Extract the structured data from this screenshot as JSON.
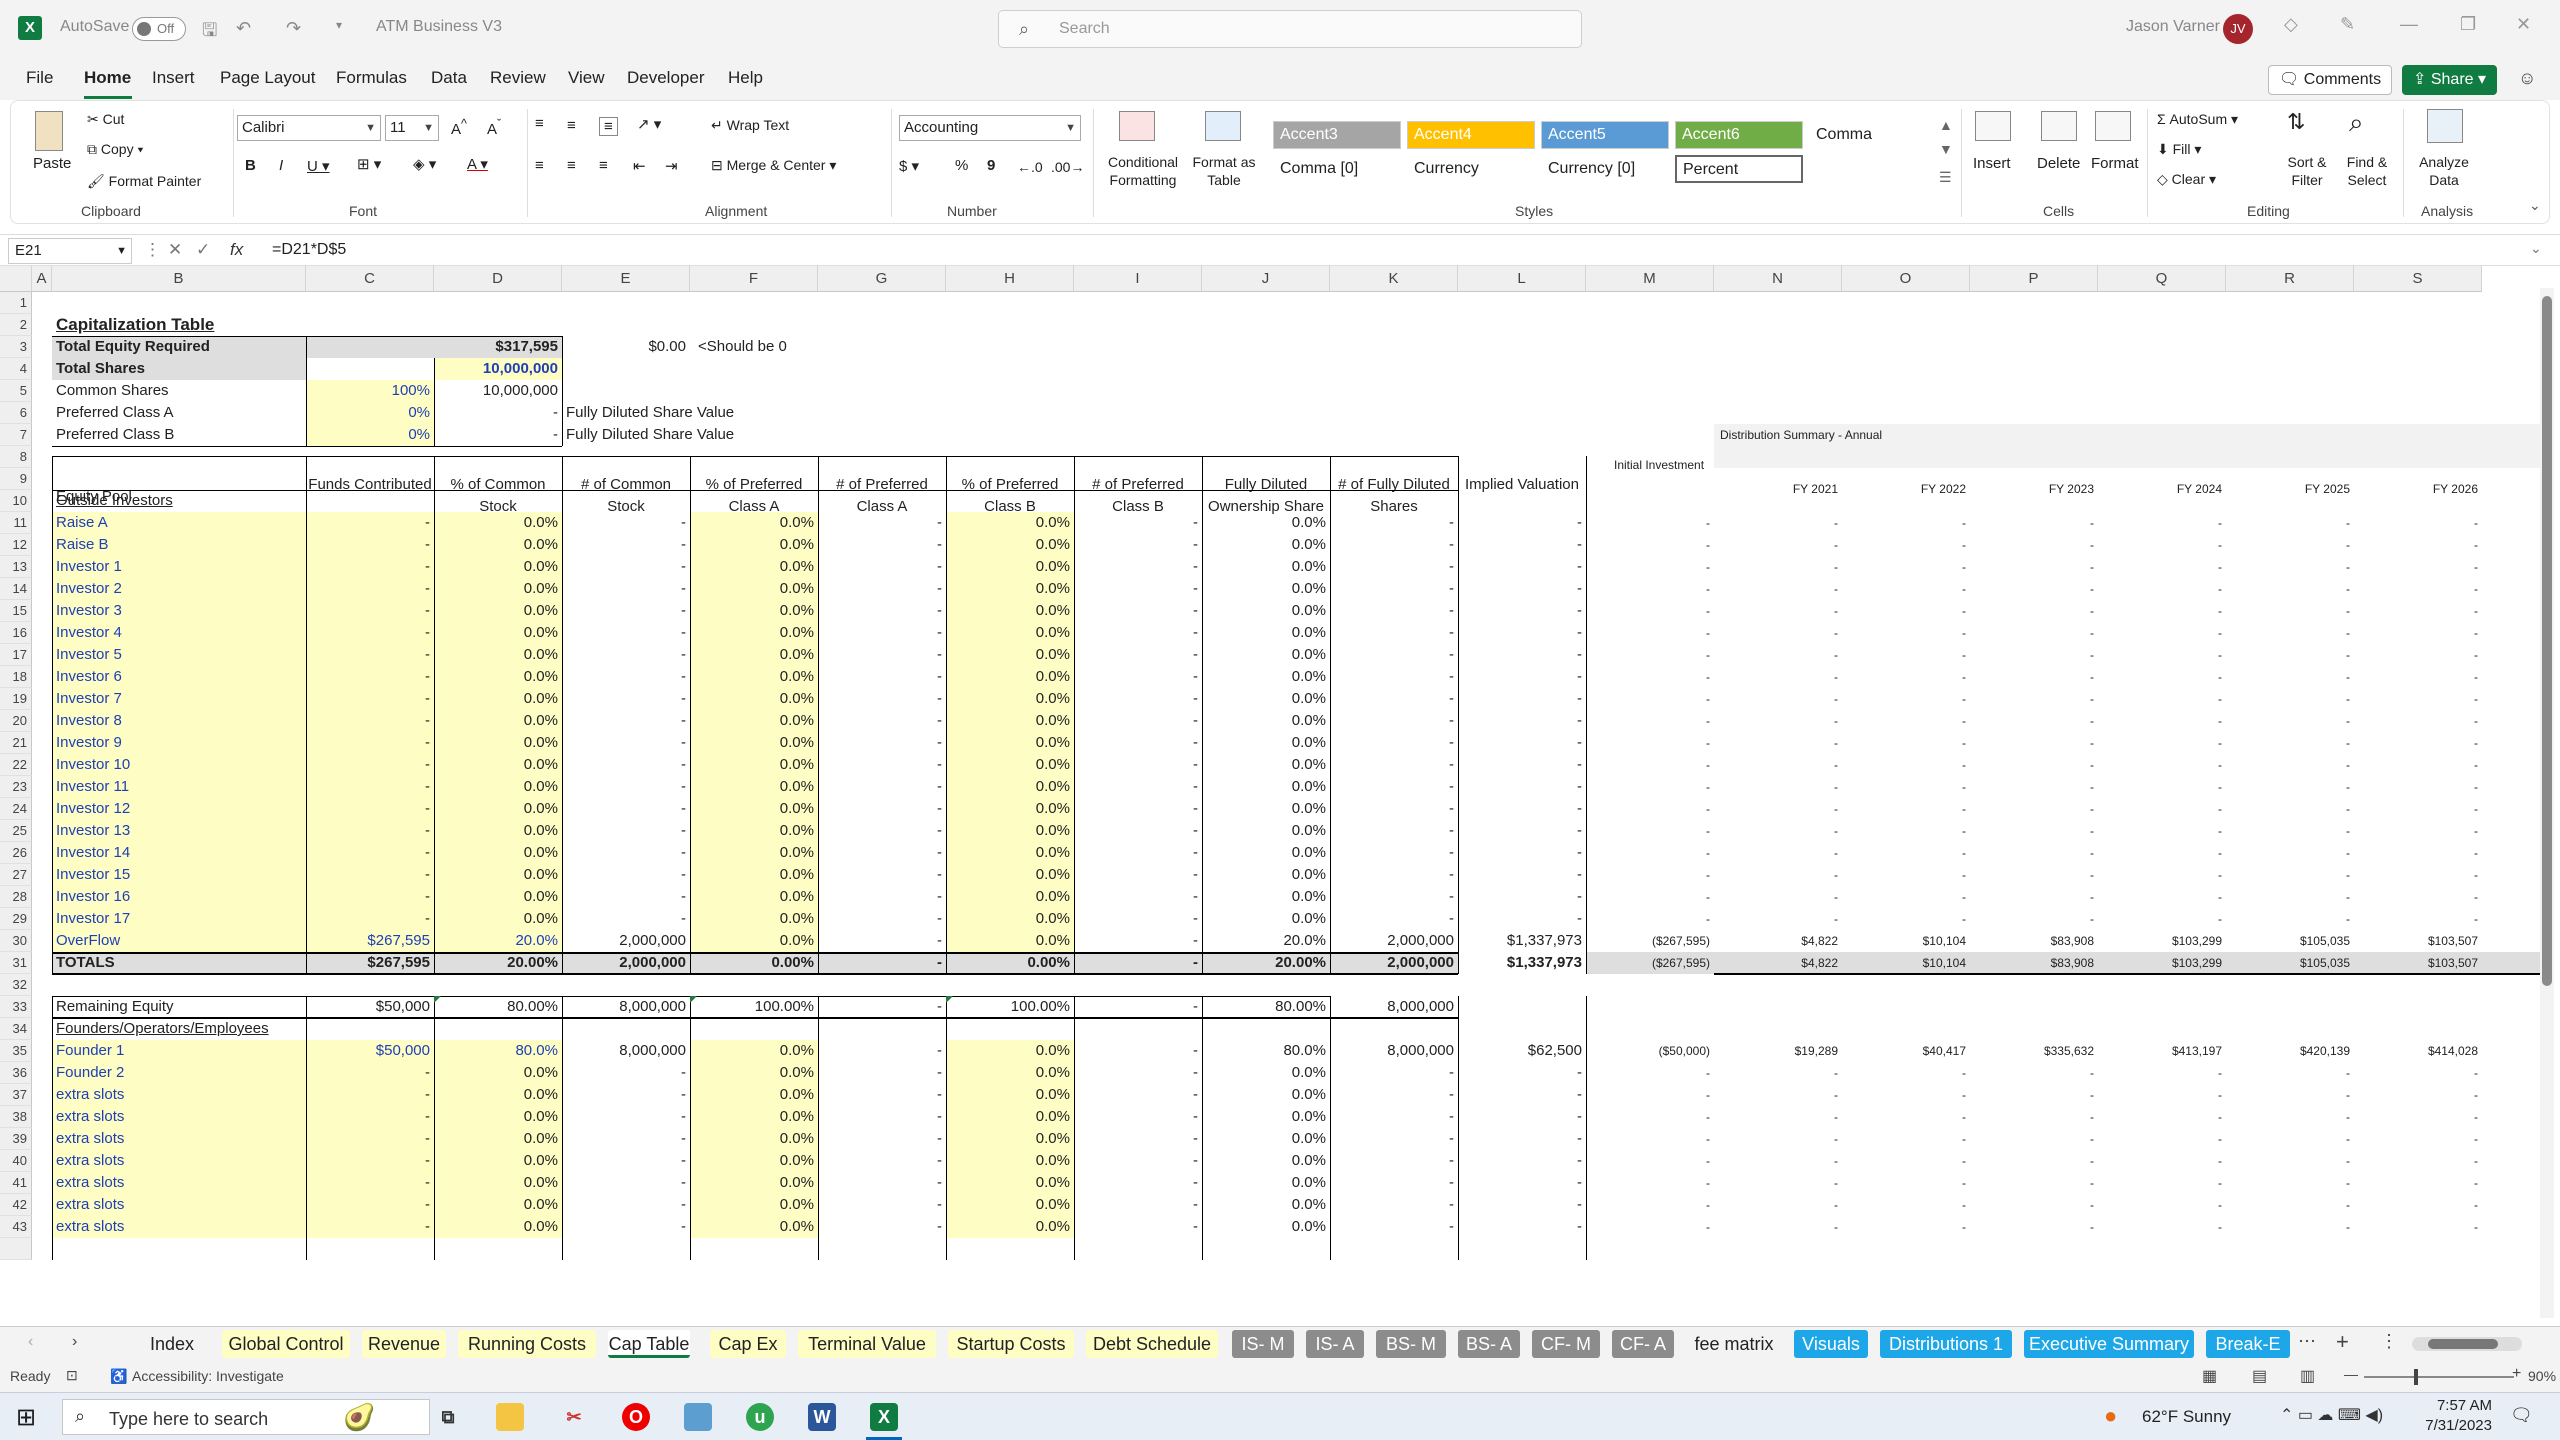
{
  "titlebar": {
    "autosave_label": "AutoSave",
    "autosave_state": "Off",
    "doc_title": "ATM Business V3",
    "search_placeholder": "Search",
    "user_name": "Jason Varner",
    "user_initials": "JV"
  },
  "menu": {
    "items": [
      "File",
      "Home",
      "Insert",
      "Page Layout",
      "Formulas",
      "Data",
      "Review",
      "View",
      "Developer",
      "Help"
    ],
    "active": "Home",
    "comments_label": "Comments",
    "share_label": "Share"
  },
  "ribbon": {
    "clipboard": {
      "paste": "Paste",
      "cut": "Cut",
      "copy": "Copy",
      "format_painter": "Format Painter",
      "group": "Clipboard"
    },
    "font": {
      "name": "Calibri",
      "size": "11",
      "group": "Font"
    },
    "alignment": {
      "wrap": "Wrap Text",
      "merge": "Merge & Center",
      "group": "Alignment"
    },
    "number": {
      "format": "Accounting",
      "group": "Number"
    },
    "styles": {
      "conditional": "Conditional Formatting",
      "format_table": "Format as Table",
      "cells": [
        "Accent3",
        "Accent4",
        "Accent5",
        "Accent6",
        "Comma",
        "Comma [0]",
        "Currency",
        "Currency [0]",
        "Percent"
      ],
      "group": "Styles"
    },
    "cells": {
      "insert": "Insert",
      "delete": "Delete",
      "format": "Format",
      "group": "Cells"
    },
    "editing": {
      "autosum": "AutoSum",
      "fill": "Fill",
      "clear": "Clear",
      "sort": "Sort & Filter",
      "find": "Find & Select",
      "group": "Editing"
    },
    "analysis": {
      "analyze": "Analyze Data",
      "group": "Analysis"
    }
  },
  "formula_bar": {
    "name_box": "E21",
    "formula": "=D21*D$5"
  },
  "columns": [
    "A",
    "B",
    "C",
    "D",
    "E",
    "F",
    "G",
    "H",
    "I",
    "J",
    "K",
    "L",
    "M",
    "N",
    "O",
    "P",
    "Q",
    "R",
    "S"
  ],
  "sheet": {
    "title": "Capitalization Table",
    "total_equity_label": "Total Equity Required",
    "total_equity": "$317,595",
    "check_value": "$0.00",
    "check_note": "<Should be 0",
    "total_shares_label": "Total Shares",
    "total_shares": "10,000,000",
    "common_label": "Common Shares",
    "common_pct": "100%",
    "common_val": "10,000,000",
    "prefA_label": "Preferred Class A",
    "prefA_pct": "0%",
    "prefA_val": "-",
    "prefB_label": "Preferred Class B",
    "prefB_pct": "0%",
    "prefB_val": "-",
    "fdsv": "Fully Diluted Share Value",
    "dist_title": "Distribution Summary - Annual",
    "initial_investment": "Initial Investment",
    "fy": [
      "FY 2021",
      "FY 2022",
      "FY 2023",
      "FY 2024",
      "FY 2025",
      "FY 2026"
    ],
    "headers": {
      "pool": "Equity Pool",
      "funds": "Funds Contributed",
      "pct_common": "% of Common Stock",
      "num_common": "# of Common Stock",
      "pct_prefA": "% of Preferred Class A",
      "num_prefA": "# of Preferred Class A",
      "pct_prefB": "% of Preferred Class B",
      "num_prefB": "# of Preferred Class B",
      "fd_own": "Fully Diluted Ownership Share",
      "fd_shares": "# of Fully Diluted Shares",
      "implied": "Implied Valuation"
    },
    "outside_label": "Outside Investors",
    "outside_rows": [
      "Raise A",
      "Raise B",
      "Investor 1",
      "Investor 2",
      "Investor 3",
      "Investor 4",
      "Investor 5",
      "Investor 6",
      "Investor 7",
      "Investor 8",
      "Investor 9",
      "Investor 10",
      "Investor 11",
      "Investor 12",
      "Investor 13",
      "Investor 14",
      "Investor 15",
      "Investor 16",
      "Investor 17"
    ],
    "empty": {
      "dash": "-",
      "pct": "0.0%"
    },
    "overflow": {
      "label": "OverFlow",
      "funds": "$267,595",
      "pct_common": "20.0%",
      "num_common": "2,000,000",
      "pct_prefA": "0.0%",
      "num_prefA": "-",
      "pct_prefB": "0.0%",
      "num_prefB": "-",
      "fd_own": "20.0%",
      "fd_shares": "2,000,000",
      "implied": "$1,337,973",
      "dist": [
        "($267,595)",
        "$4,822",
        "$10,104",
        "$83,908",
        "$103,299",
        "$105,035",
        "$103,507"
      ]
    },
    "totals": {
      "label": "TOTALS",
      "funds": "$267,595",
      "pct_common": "20.00%",
      "num_common": "2,000,000",
      "pct_prefA": "0.00%",
      "num_prefA": "-",
      "pct_prefB": "0.00%",
      "num_prefB": "-",
      "fd_own": "20.00%",
      "fd_shares": "2,000,000",
      "implied": "$1,337,973",
      "dist": [
        "($267,595)",
        "$4,822",
        "$10,104",
        "$83,908",
        "$103,299",
        "$105,035",
        "$103,507"
      ]
    },
    "remaining": {
      "label": "Remaining Equity",
      "funds": "$50,000",
      "pct_common": "80.00%",
      "num_common": "8,000,000",
      "pct_prefA": "100.00%",
      "num_prefA": "-",
      "pct_prefB": "100.00%",
      "num_prefB": "-",
      "fd_own": "80.00%",
      "fd_shares": "8,000,000"
    },
    "founders_label": "Founders/Operators/Employees",
    "founder1": {
      "label": "Founder 1",
      "funds": "$50,000",
      "pct_common": "80.0%",
      "num_common": "8,000,000",
      "pct_prefA": "0.0%",
      "num_prefA": "-",
      "pct_prefB": "0.0%",
      "num_prefB": "-",
      "fd_own": "80.0%",
      "fd_shares": "8,000,000",
      "implied": "$62,500",
      "dist": [
        "($50,000)",
        "$19,289",
        "$40,417",
        "$335,632",
        "$413,197",
        "$420,139",
        "$414,028"
      ]
    },
    "founder_rows": [
      "Founder 2",
      "extra slots",
      "extra slots",
      "extra slots",
      "extra slots",
      "extra slots",
      "extra slots",
      "extra slots"
    ]
  },
  "tabs": {
    "items": [
      {
        "label": "Index",
        "color": "#f3f3f3",
        "fg": "#222"
      },
      {
        "label": "Global Control",
        "color": "#fdfdc4",
        "fg": "#222"
      },
      {
        "label": "Revenue",
        "color": "#fdfdc4",
        "fg": "#222"
      },
      {
        "label": "Running Costs",
        "color": "#fdfdc4",
        "fg": "#222"
      },
      {
        "label": "Cap Table",
        "color": "#ffffff",
        "fg": "#222"
      },
      {
        "label": "Cap Ex",
        "color": "#fdfdc4",
        "fg": "#222"
      },
      {
        "label": "Terminal Value",
        "color": "#fdfdc4",
        "fg": "#222"
      },
      {
        "label": "Startup Costs",
        "color": "#fdfdc4",
        "fg": "#222"
      },
      {
        "label": "Debt Schedule",
        "color": "#fdfdc4",
        "fg": "#222"
      },
      {
        "label": "IS- M",
        "color": "#8c8c8c",
        "fg": "#fff"
      },
      {
        "label": "IS- A",
        "color": "#8c8c8c",
        "fg": "#fff"
      },
      {
        "label": "BS- M",
        "color": "#8c8c8c",
        "fg": "#fff"
      },
      {
        "label": "BS- A",
        "color": "#8c8c8c",
        "fg": "#fff"
      },
      {
        "label": "CF- M",
        "color": "#8c8c8c",
        "fg": "#fff"
      },
      {
        "label": "CF- A",
        "color": "#8c8c8c",
        "fg": "#fff"
      },
      {
        "label": "fee matrix",
        "color": "#f3f3f3",
        "fg": "#222"
      },
      {
        "label": "Visuals",
        "color": "#1ea7e8",
        "fg": "#fff"
      },
      {
        "label": "Distributions 1",
        "color": "#1ea7e8",
        "fg": "#fff"
      },
      {
        "label": "Executive Summary",
        "color": "#1ea7e8",
        "fg": "#fff"
      },
      {
        "label": "Break-E",
        "color": "#1ea7e8",
        "fg": "#fff"
      }
    ],
    "active": "Cap Table"
  },
  "status": {
    "ready": "Ready",
    "accessibility": "Accessibility: Investigate",
    "zoom": "90%"
  },
  "taskbar": {
    "search": "Type here to search",
    "weather": "62°F  Sunny",
    "time": "7:57 AM",
    "date": "7/31/2023"
  }
}
